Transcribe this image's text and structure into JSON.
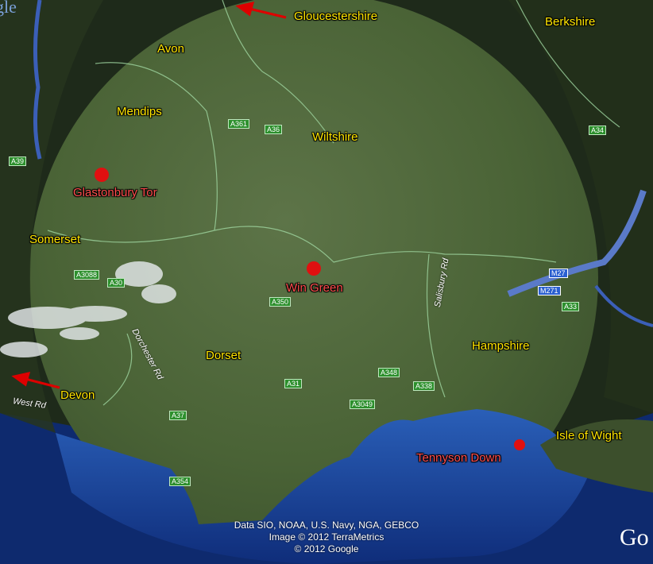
{
  "regions": [
    {
      "id": "gloucestershire",
      "label": "Gloucestershire"
    },
    {
      "id": "berkshire",
      "label": "Berkshire"
    },
    {
      "id": "avon",
      "label": "Avon"
    },
    {
      "id": "mendips",
      "label": "Mendips"
    },
    {
      "id": "wiltshire",
      "label": "Wiltshire"
    },
    {
      "id": "somerset",
      "label": "Somerset"
    },
    {
      "id": "dorset",
      "label": "Dorset"
    },
    {
      "id": "hampshire",
      "label": "Hampshire"
    },
    {
      "id": "devon",
      "label": "Devon"
    },
    {
      "id": "isle_of_wight",
      "label": "Isle of Wight"
    }
  ],
  "places": [
    {
      "id": "glastonbury_tor",
      "label": "Glastonbury Tor"
    },
    {
      "id": "win_green",
      "label": "Win Green"
    },
    {
      "id": "tennyson_down",
      "label": "Tennyson Down"
    }
  ],
  "roads": [
    "A361",
    "A36",
    "A39",
    "A3088",
    "A30",
    "A350",
    "A31",
    "A348",
    "A338",
    "A3049",
    "A37",
    "A354",
    "A33",
    "A34",
    "M27",
    "M271"
  ],
  "streets": [
    "Dorchester Rd",
    "Salisbury Rd",
    "West Rd"
  ],
  "credits": {
    "line1": "Data SIO, NOAA, U.S. Navy, NGA, GEBCO",
    "line2": "Image © 2012 TerraMetrics",
    "line3": "© 2012 Google"
  },
  "logo_left": "gle",
  "logo_right": "Go",
  "colors": {
    "region_label": "#ffe600",
    "place_label": "#ff4d4d",
    "marker": "#e01010",
    "sea": "#1b3f8f",
    "land": "#4f6a3a"
  }
}
